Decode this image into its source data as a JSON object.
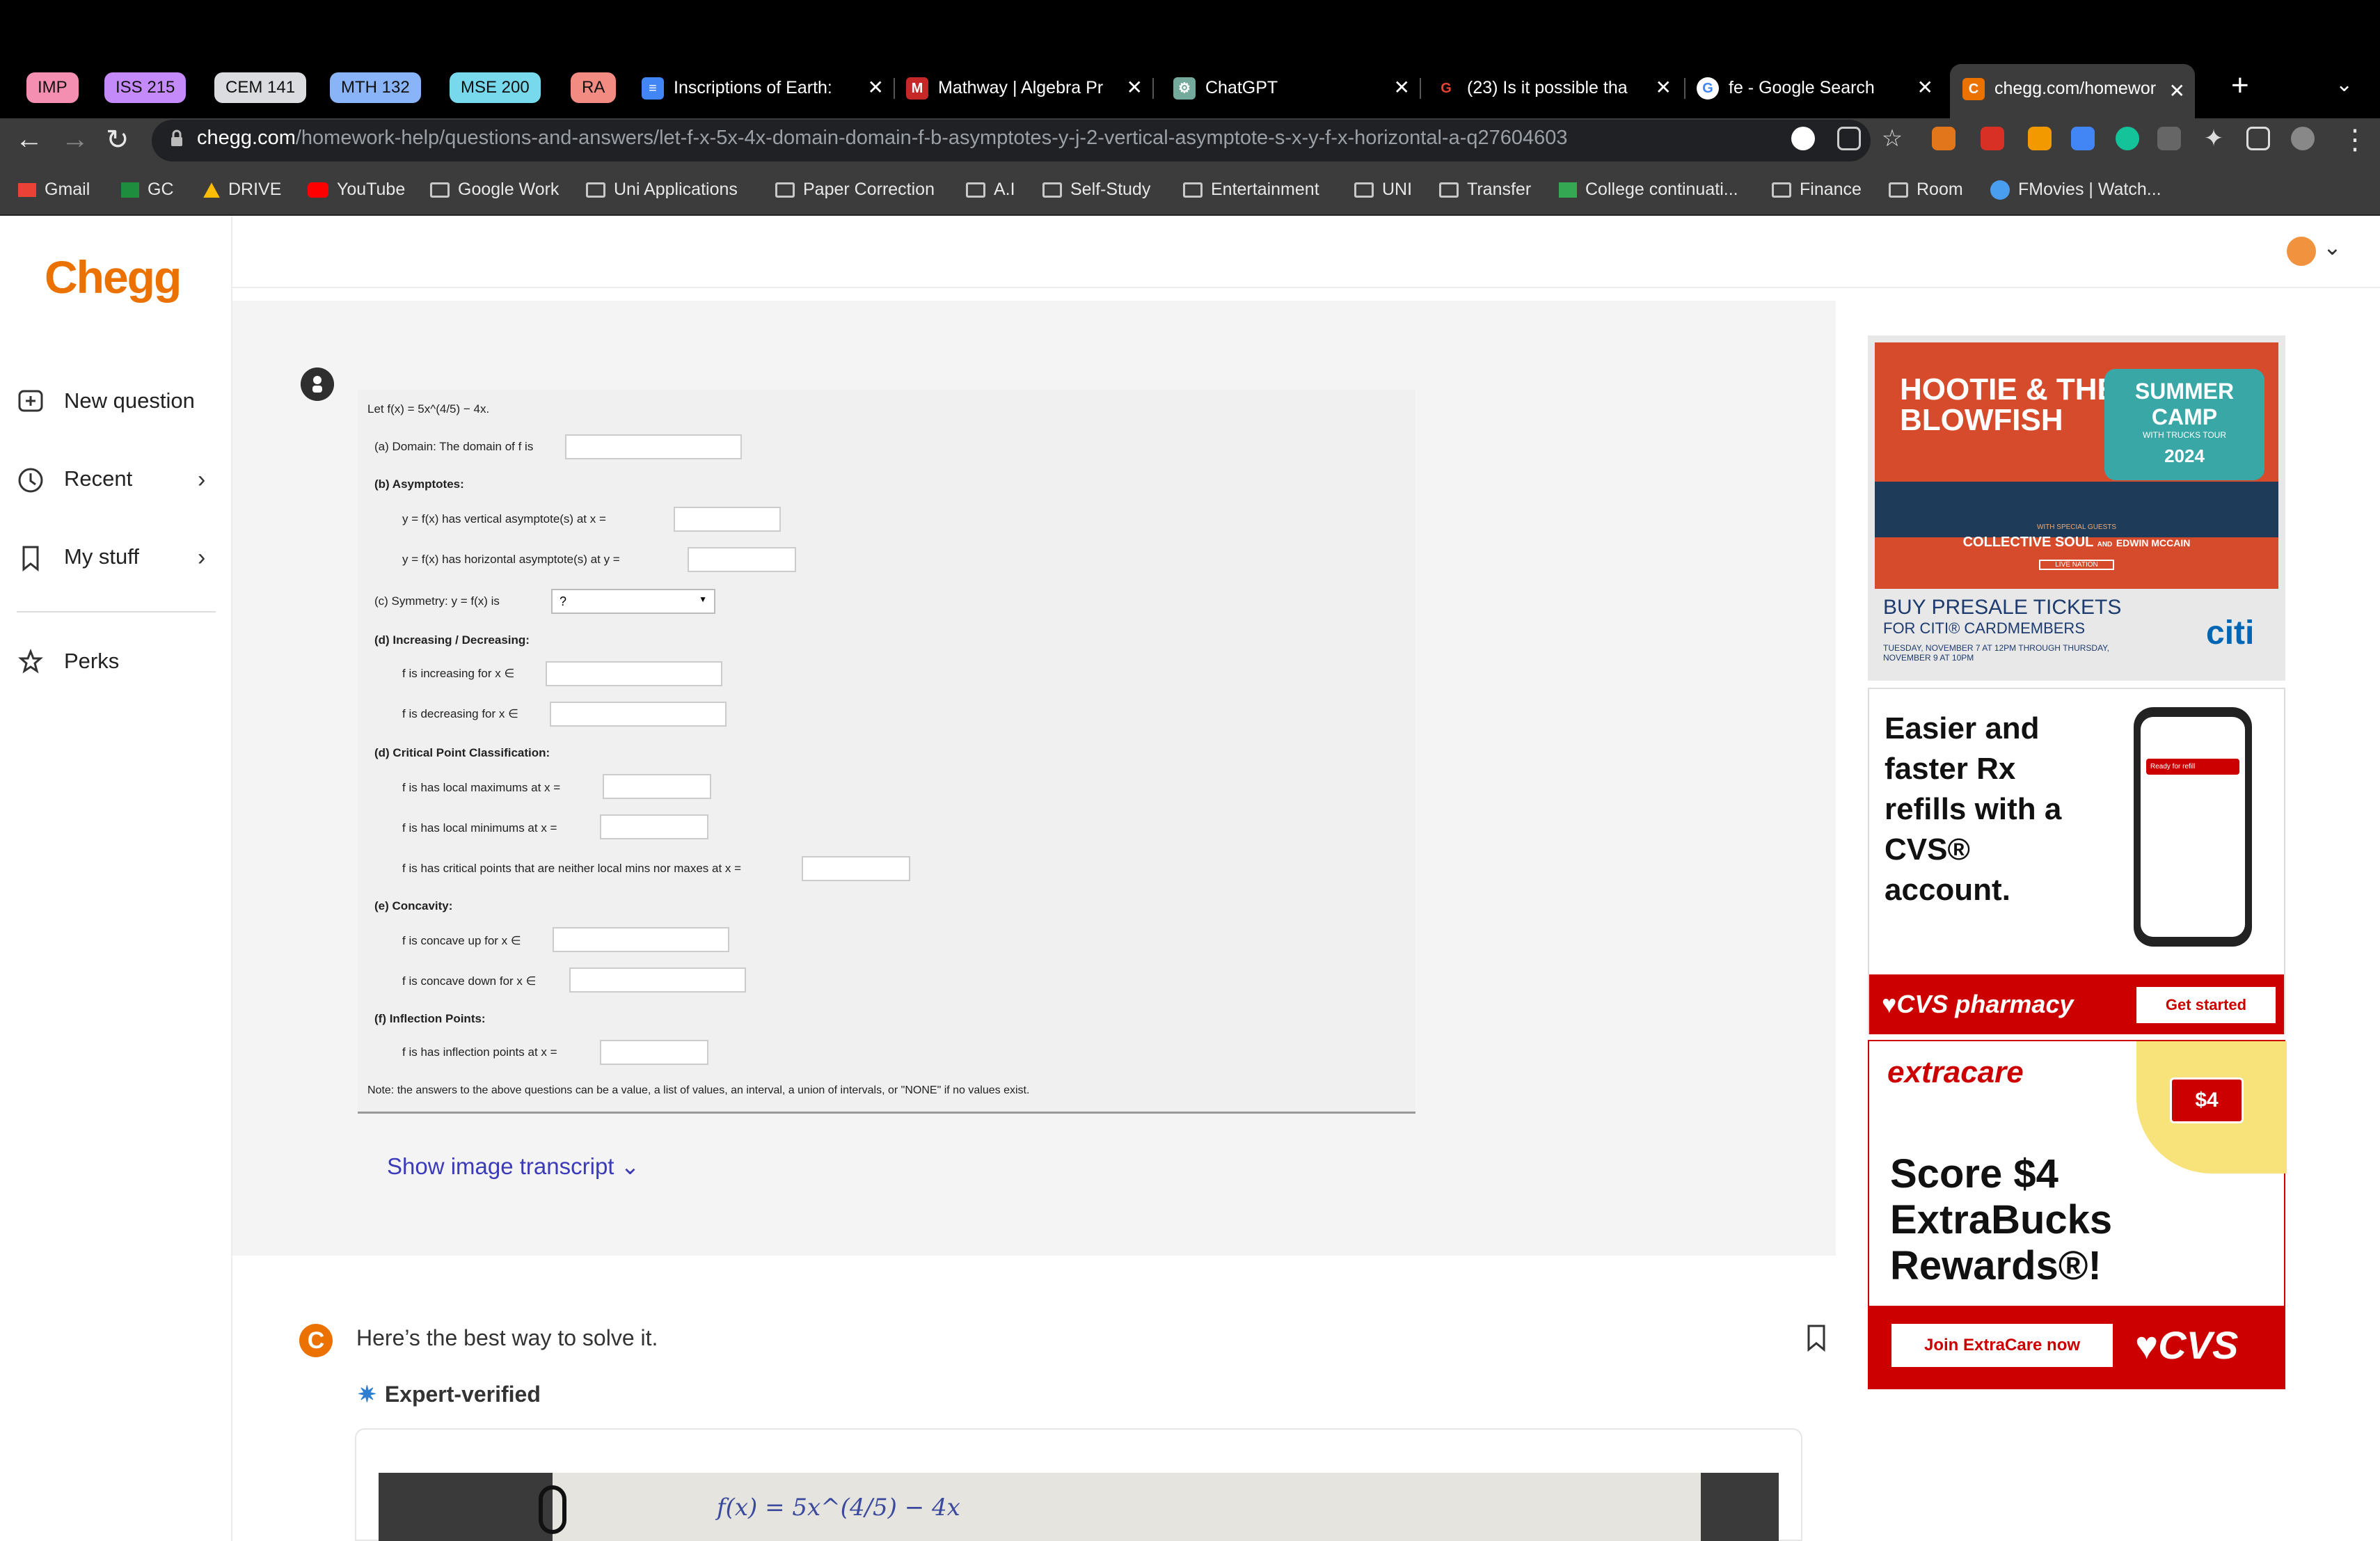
{
  "tab_groups": [
    {
      "label": "IMP",
      "color": "#f48fb1"
    },
    {
      "label": "ISS 215",
      "color": "#c58af9"
    },
    {
      "label": "CEM 141",
      "color": "#dadce0"
    },
    {
      "label": "MTH 132",
      "color": "#8ab4f8"
    },
    {
      "label": "MSE 200",
      "color": "#78d9ec"
    },
    {
      "label": "RA",
      "color": "#f28b82"
    }
  ],
  "tabs": [
    {
      "title": "Inscriptions of Earth:"
    },
    {
      "title": "Mathway | Algebra Pr"
    },
    {
      "title": "ChatGPT"
    },
    {
      "title": "(23) Is it possible tha"
    },
    {
      "title": "fe - Google Search"
    },
    {
      "title": "chegg.com/homewor"
    }
  ],
  "address": {
    "host": "chegg.com",
    "path": "/homework-help/questions-and-answers/let-f-x-5x-4x-domain-domain-f-b-asymptotes-y-j-2-vertical-asymptote-s-x-y-f-x-horizontal-a-q27604603"
  },
  "bookmarks": [
    "Gmail",
    "GC",
    "DRIVE",
    "YouTube",
    "Google Work",
    "Uni Applications",
    "Paper Correction",
    "A.I",
    "Self-Study",
    "Entertainment",
    "UNI",
    "Transfer",
    "College continuati...",
    "Finance",
    "Room",
    "FMovies | Watch..."
  ],
  "sidebar": {
    "logo": "Chegg",
    "items": [
      "New question",
      "Recent",
      "My stuff",
      "Perks"
    ]
  },
  "question": {
    "line1": "Let f(x) = 5x^(4/5) − 4x.",
    "a": "(a) Domain: The domain of f is",
    "b": "(b) Asymptotes:",
    "b1": "y = f(x) has vertical asymptote(s) at x =",
    "b2": "y = f(x) has horizontal asymptote(s) at y =",
    "c": "(c) Symmetry: y = f(x) is",
    "c_select": "?",
    "d": "(d) Increasing / Decreasing:",
    "d1": "f is increasing for x ∈",
    "d2": "f is decreasing for x ∈",
    "e_cp": "(d) Critical Point Classification:",
    "cp1": "f is has local maximums at x =",
    "cp2": "f is has local minimums at x =",
    "cp3": "f is has critical points that are neither local mins nor maxes at x =",
    "e": "(e) Concavity:",
    "e1": "f is concave up for x ∈",
    "e2": "f is concave down for x ∈",
    "f": "(f) Inflection Points:",
    "f1": "f is has inflection points at x =",
    "note": "Note: the answers to the above questions can be a value, a list of values, an interval, a union of intervals, or \"NONE\" if no values exist."
  },
  "transcript_label": "Show image transcript",
  "answer": {
    "badge": "C",
    "heading": "Here’s the best way to solve it.",
    "verified": "Expert-verified",
    "handwriting": "f(x) = 5x^(4/5) − 4x"
  },
  "ads": {
    "ad1": {
      "band": "HOOTIE & THE BLOWFISH",
      "camp": "SUMMER CAMP",
      "camp_sub": "WITH TRUCKS TOUR",
      "year": "2024",
      "guests_label": "WITH SPECIAL GUESTS",
      "guests": "COLLECTIVE SOUL",
      "guests_and": "AND",
      "guest2": "EDWIN MCCAIN",
      "presenter": "LIVE NATION",
      "headline": "BUY PRESALE TICKETS",
      "sub": "FOR CITI® CARDMEMBERS",
      "dates": "TUESDAY, NOVEMBER 7 AT 12PM THROUGH THURSDAY, NOVEMBER 9 AT 10PM",
      "brand": "citi"
    },
    "ad2": {
      "headline": "Easier and faster Rx refills with a CVS® account.",
      "brand": "CVS pharmacy",
      "cta": "Get started",
      "phone_label": "Ready for refill"
    },
    "ad3": {
      "brand": "extracare",
      "coupon": "$4",
      "headline": "Score $4 ExtraBucks Rewards®!",
      "cta": "Join ExtraCare now",
      "logo": "CVS"
    }
  }
}
